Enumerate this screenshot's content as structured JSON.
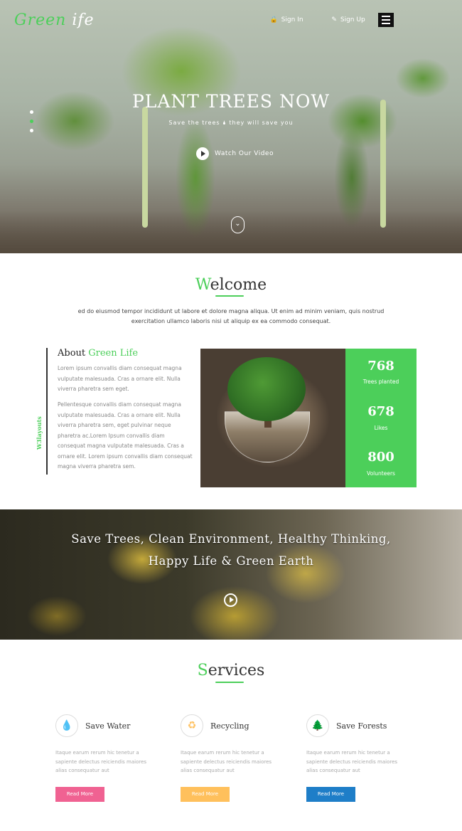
{
  "header": {
    "logo_left": "Green",
    "logo_right": "ife",
    "sign_in": "Sign In",
    "sign_up": "Sign Up"
  },
  "hero": {
    "title": "PLANT TREES NOW",
    "subtitle": "Save the trees 🌢 they will save you",
    "video_label": "Watch Our Video"
  },
  "welcome": {
    "title_first": "W",
    "title_rest": "elcome",
    "text": "ed do eiusmod tempor incididunt ut labore et dolore magna aliqua. Ut enim ad minim veniam, quis nostrud exercitation ullamco laboris nisi ut aliquip ex ea commodo consequat."
  },
  "about": {
    "title_prefix": "About ",
    "title_highlight": "Green Life",
    "para1": "Lorem ipsum convallis diam consequat magna vulputate malesuada. Cras a ornare elit. Nulla viverra pharetra sem eget.",
    "para2": "Pellentesque convallis diam consequat magna vulputate malesuada. Cras a ornare elit. Nulla viverra pharetra sem, eget pulvinar neque pharetra ac.Lorem Ipsum convallis diam consequat magna vulputate malesuada. Cras a ornare elit. Lorem ipsum convallis diam consequat magna viverra pharetra sem.",
    "vertical_label": "W3layouts"
  },
  "stats": [
    {
      "num": "768",
      "label": "Trees planted"
    },
    {
      "num": "678",
      "label": "Likes"
    },
    {
      "num": "800",
      "label": "Volunteers"
    }
  ],
  "banner": {
    "line1": "Save Trees, Clean Environment, Healthy Thinking,",
    "line2": "Happy Life & Green Earth"
  },
  "services": {
    "title_first": "S",
    "title_rest": "ervices",
    "items": [
      {
        "title": "Save Water",
        "icon": "water-drop-icon",
        "desc": "Itaque earum rerum hic tenetur a sapiente delectus reiciendis maiores alias consequatur aut",
        "button": "Read More",
        "color": "#f06292"
      },
      {
        "title": "Recycling",
        "icon": "recycle-icon",
        "desc": "Itaque earum rerum hic tenetur a sapiente delectus reiciendis maiores alias consequatur aut",
        "button": "Read More",
        "color": "#ffc05c"
      },
      {
        "title": "Save Forests",
        "icon": "tree-icon",
        "desc": "Itaque earum rerum hic tenetur a sapiente delectus reiciendis maiores alias consequatur aut",
        "button": "Read More",
        "color": "#1e7ec8"
      }
    ]
  },
  "colors": {
    "accent": "#4ccf5a"
  }
}
